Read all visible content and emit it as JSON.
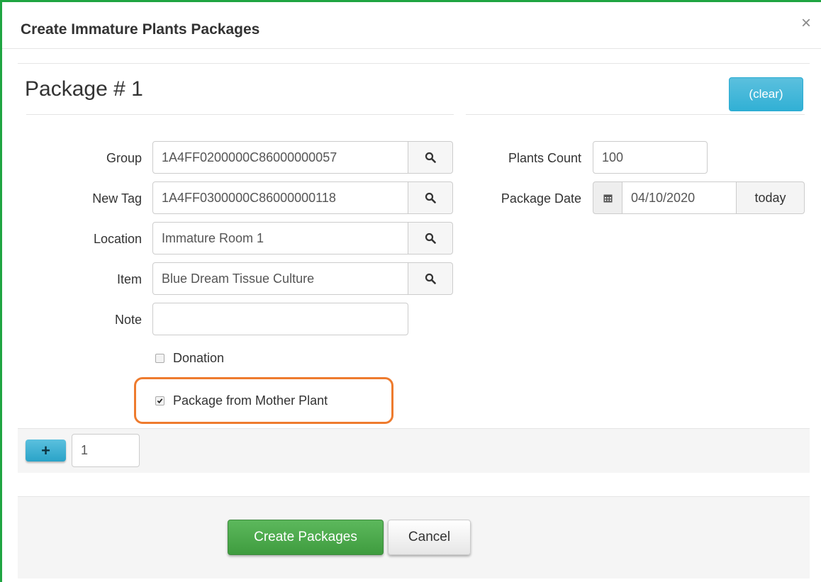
{
  "modal": {
    "title": "Create Immature Plants Packages",
    "close_glyph": "×"
  },
  "package": {
    "heading": "Package # 1",
    "clear_label": "(clear)",
    "fields": {
      "group": {
        "label": "Group",
        "value": "1A4FF0200000C86000000057"
      },
      "new_tag": {
        "label": "New Tag",
        "value": "1A4FF0300000C86000000118"
      },
      "location": {
        "label": "Location",
        "value": "Immature Room 1"
      },
      "item": {
        "label": "Item",
        "value": "Blue Dream Tissue Culture"
      },
      "note": {
        "label": "Note",
        "value": ""
      },
      "plants_count": {
        "label": "Plants Count",
        "value": "100"
      },
      "package_date": {
        "label": "Package Date",
        "value": "04/10/2020",
        "today_label": "today"
      }
    },
    "donation": {
      "label": "Donation",
      "checked": false
    },
    "from_mother": {
      "label": "Package from Mother Plant",
      "checked": true
    }
  },
  "add_row": {
    "plus_glyph": "+",
    "count": "1"
  },
  "footer": {
    "create_label": "Create Packages",
    "cancel_label": "Cancel"
  },
  "colors": {
    "accent_blue": "#31b0d5",
    "success_green": "#4cae4c",
    "highlight_orange": "#ee7b2e",
    "frame_green": "#1fa541"
  }
}
